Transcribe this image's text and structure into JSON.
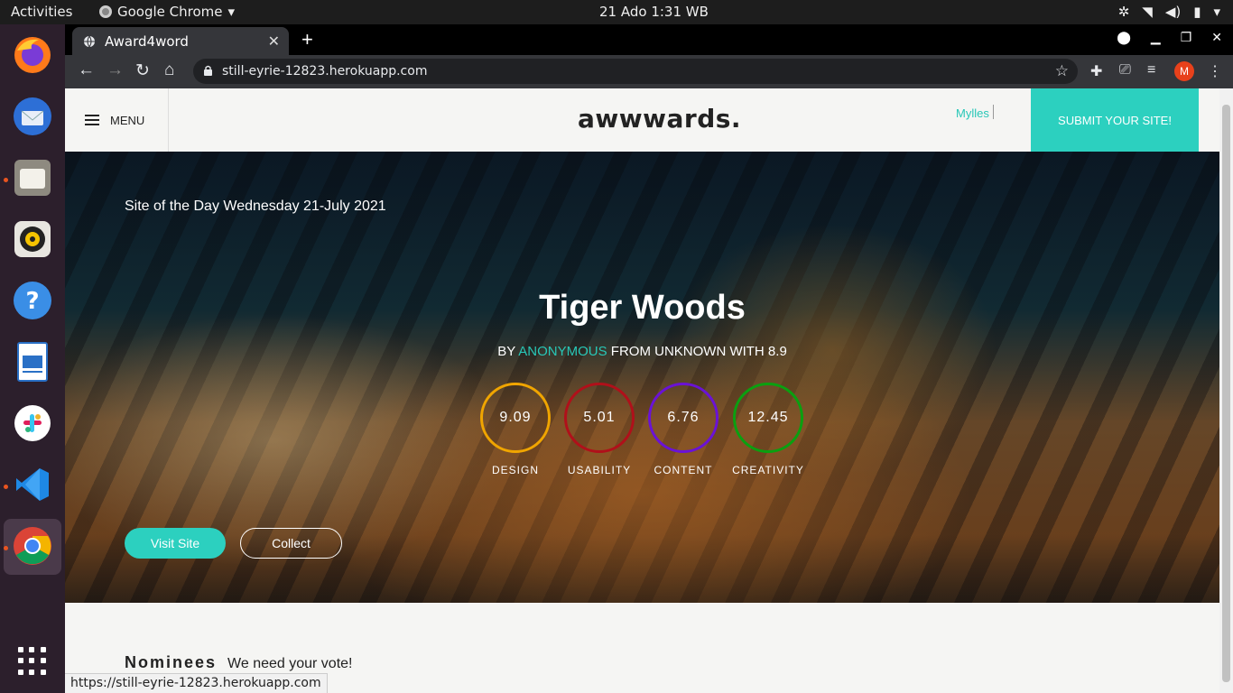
{
  "system": {
    "activities": "Activities",
    "app_menu": "Google Chrome",
    "clock": "21 Ado  1:31 WB"
  },
  "dock": {
    "apps": [
      "firefox-icon",
      "thunderbird-icon",
      "files-icon",
      "rhythmbox-icon",
      "help-icon",
      "libreoffice-writer-icon",
      "slack-icon",
      "vscode-icon",
      "chrome-icon"
    ]
  },
  "browser": {
    "tab_title": "Award4word",
    "url": "still-eyrie-12823.herokuapp.com",
    "profile_initial": "M",
    "status_url": "https://still-eyrie-12823.herokuapp.com"
  },
  "site": {
    "menu_label": "MENU",
    "logo": "awwwards.",
    "username": "Mylles",
    "submit_label": "SUBMIT YOUR SITE!",
    "hero": {
      "site_of_day": "Site of the Day  Wednesday 21-July 2021",
      "title": "Tiger Woods",
      "by": "BY ",
      "author": "ANONYMOUS",
      "from": " FROM UNKNOWN WITH 8.9",
      "scores": [
        {
          "value": "9.09",
          "label": "DESIGN",
          "color": "#f0a500"
        },
        {
          "value": "5.01",
          "label": "USABILITY",
          "color": "#b0101a"
        },
        {
          "value": "6.76",
          "label": "CONTENT",
          "color": "#6a12d6"
        },
        {
          "value": "12.45",
          "label": "CREATIVITY",
          "color": "#0aa010"
        }
      ],
      "visit_label": "Visit Site",
      "collect_label": "Collect"
    },
    "nominees": {
      "heading": "Nominees",
      "sub": "We need your vote!"
    }
  },
  "colors": {
    "accent": "#2cd0bf"
  }
}
